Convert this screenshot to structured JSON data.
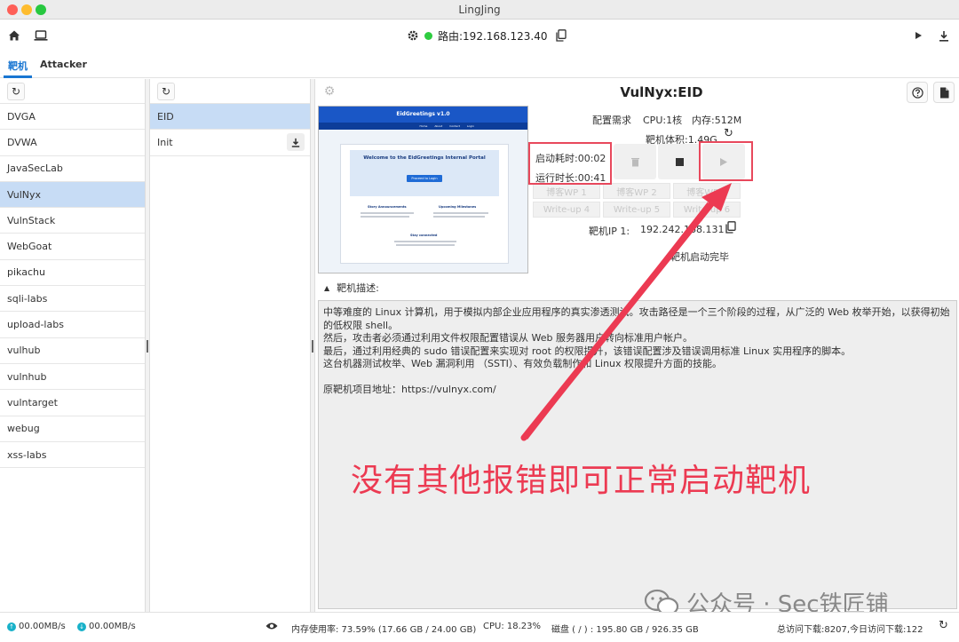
{
  "window": {
    "title": "LingJing"
  },
  "toolbar": {
    "route_label": "路由:192.168.123.40",
    "icons": [
      "home-icon",
      "laptop-icon",
      "gear-icon",
      "copy-icon",
      "play-icon",
      "download-icon"
    ],
    "status_color": "#2ecc40"
  },
  "tabs": [
    {
      "label": "靶机",
      "active": true
    },
    {
      "label": "Attacker",
      "active": false
    }
  ],
  "left_list": {
    "selected": "VulNyx",
    "items": [
      "DVGA",
      "DVWA",
      "JavaSecLab",
      "VulNyx",
      "VulnStack",
      "WebGoat",
      "pikachu",
      "sqli-labs",
      "upload-labs",
      "vulhub",
      "vulnhub",
      "vulntarget",
      "webug",
      "xss-labs"
    ]
  },
  "mid_list": {
    "selected": "EID",
    "items": [
      {
        "label": "EID",
        "has_download": false
      },
      {
        "label": "Init",
        "has_download": true
      }
    ]
  },
  "detail": {
    "title": "VulNyx:EID",
    "config_label": "配置需求",
    "cpu": "CPU:1核",
    "memory": "内存:512M",
    "size": "靶机体积:1.49G",
    "boot_time": "启动耗时:00:02",
    "run_time": "运行时长:00:41",
    "writeups": [
      "博客WP 1",
      "博客WP 2",
      "博客WP 3",
      "Write-up 4",
      "Write-up 5",
      "Write-up 6"
    ],
    "ip_label": "靶机IP 1:",
    "ip_value": "192.242.168.131",
    "status_text": "靶机启动完毕",
    "screenshot": {
      "header": "EidGreetings v1.0",
      "nav": [
        "Home",
        "About",
        "Contact",
        "Login"
      ],
      "welcome_title": "Welcome to the EidGreetings Internal Portal",
      "login_button": "Proceed to Login",
      "section1": "Story Announcements",
      "section2": "Upcoming Milestones",
      "section3": "Stay connected"
    },
    "description_label": "靶机描述:",
    "description": [
      "中等难度的 Linux 计算机，用于模拟内部企业应用程序的真实渗透测试。攻击路径是一个三个阶段的过程，从广泛的 Web 枚举开始，以获得初始的低权限 shell。",
      "然后，攻击者必须通过利用文件权限配置错误从 Web 服务器用户转向标准用户帐户。",
      "最后，通过利用经典的 sudo 错误配置来实现对 root 的权限提升，该错误配置涉及错误调用标准 Linux 实用程序的脚本。",
      "这台机器测试枚举、Web 漏洞利用 （SSTI）、有效负载制作和 Linux 权限提升方面的技能。"
    ],
    "project_url": "原靶机项目地址：https://vulnyx.com/"
  },
  "annotation": {
    "caption": "没有其他报错即可正常启动靶机",
    "color": "#ec3a52"
  },
  "watermark": "公众号 · Sec铁匠铺",
  "statusbar": {
    "upload": "00.00MB/s",
    "download": "00.00MB/s",
    "memory": "内存使用率: 73.59% (17.66 GB / 24.00 GB)",
    "cpu": "CPU: 18.23%",
    "disk": "磁盘 ( / ) : 195.80 GB / 926.35 GB",
    "visits": "总访问下载:8207,今日访问下载:122"
  }
}
